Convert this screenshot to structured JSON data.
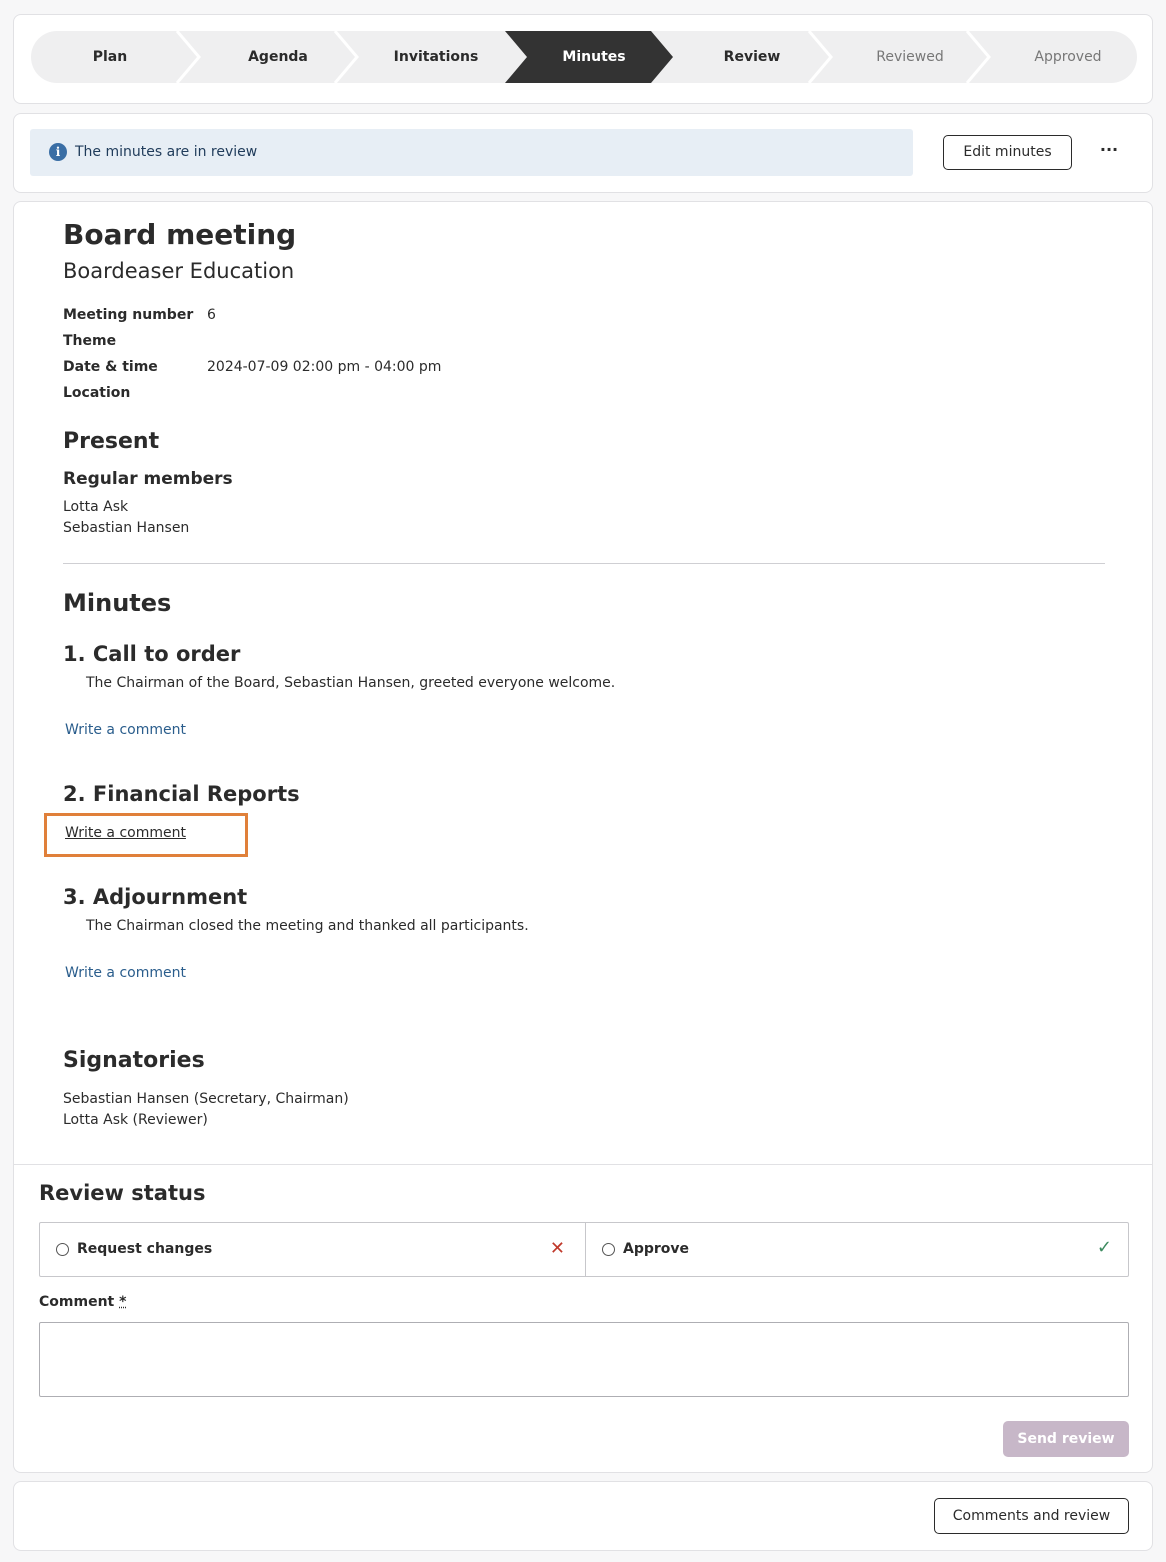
{
  "stepper": {
    "steps": [
      {
        "label": "Plan",
        "state": "done"
      },
      {
        "label": "Agenda",
        "state": "done"
      },
      {
        "label": "Invitations",
        "state": "done"
      },
      {
        "label": "Minutes",
        "state": "active"
      },
      {
        "label": "Review",
        "state": "next"
      },
      {
        "label": "Reviewed",
        "state": "future"
      },
      {
        "label": "Approved",
        "state": "future"
      }
    ],
    "colors": {
      "inactive": "#efeff0",
      "active": "#333333",
      "separator": "#ffffff"
    }
  },
  "info": {
    "message": "The minutes are in review",
    "icon": "info-icon",
    "edit_label": "Edit minutes",
    "more_label": "···"
  },
  "meeting": {
    "title": "Board meeting",
    "organization": "Boardeaser Education",
    "fields": [
      {
        "label": "Meeting number",
        "value": "6"
      },
      {
        "label": "Theme",
        "value": ""
      },
      {
        "label": "Date & time",
        "value": "2024-07-09 02:00 pm - 04:00 pm"
      },
      {
        "label": "Location",
        "value": ""
      }
    ]
  },
  "present": {
    "heading": "Present",
    "group": "Regular members",
    "members": [
      "Lotta Ask",
      "Sebastian Hansen"
    ]
  },
  "minutes": {
    "heading": "Minutes",
    "items": [
      {
        "title": "1. Call to order",
        "body": "The Chairman of the Board, Sebastian Hansen, greeted everyone welcome.",
        "comment_link": "Write a comment"
      },
      {
        "title": "2. Financial Reports",
        "body": "",
        "comment_link": "Write a comment"
      },
      {
        "title": "3. Adjournment",
        "body": "The Chairman closed the meeting and thanked all participants.",
        "comment_link": "Write a comment"
      }
    ]
  },
  "signatories": {
    "heading": "Signatories",
    "list": [
      "Sebastian Hansen (Secretary, Chairman)",
      "Lotta Ask (Reviewer)"
    ]
  },
  "review": {
    "heading": "Review status",
    "request_changes": "Request changes",
    "approve": "Approve",
    "comment_label": "Comment",
    "required_mark": "*",
    "comment_value": "",
    "send_label": "Send review"
  },
  "footer": {
    "comments_review_label": "Comments and review"
  }
}
